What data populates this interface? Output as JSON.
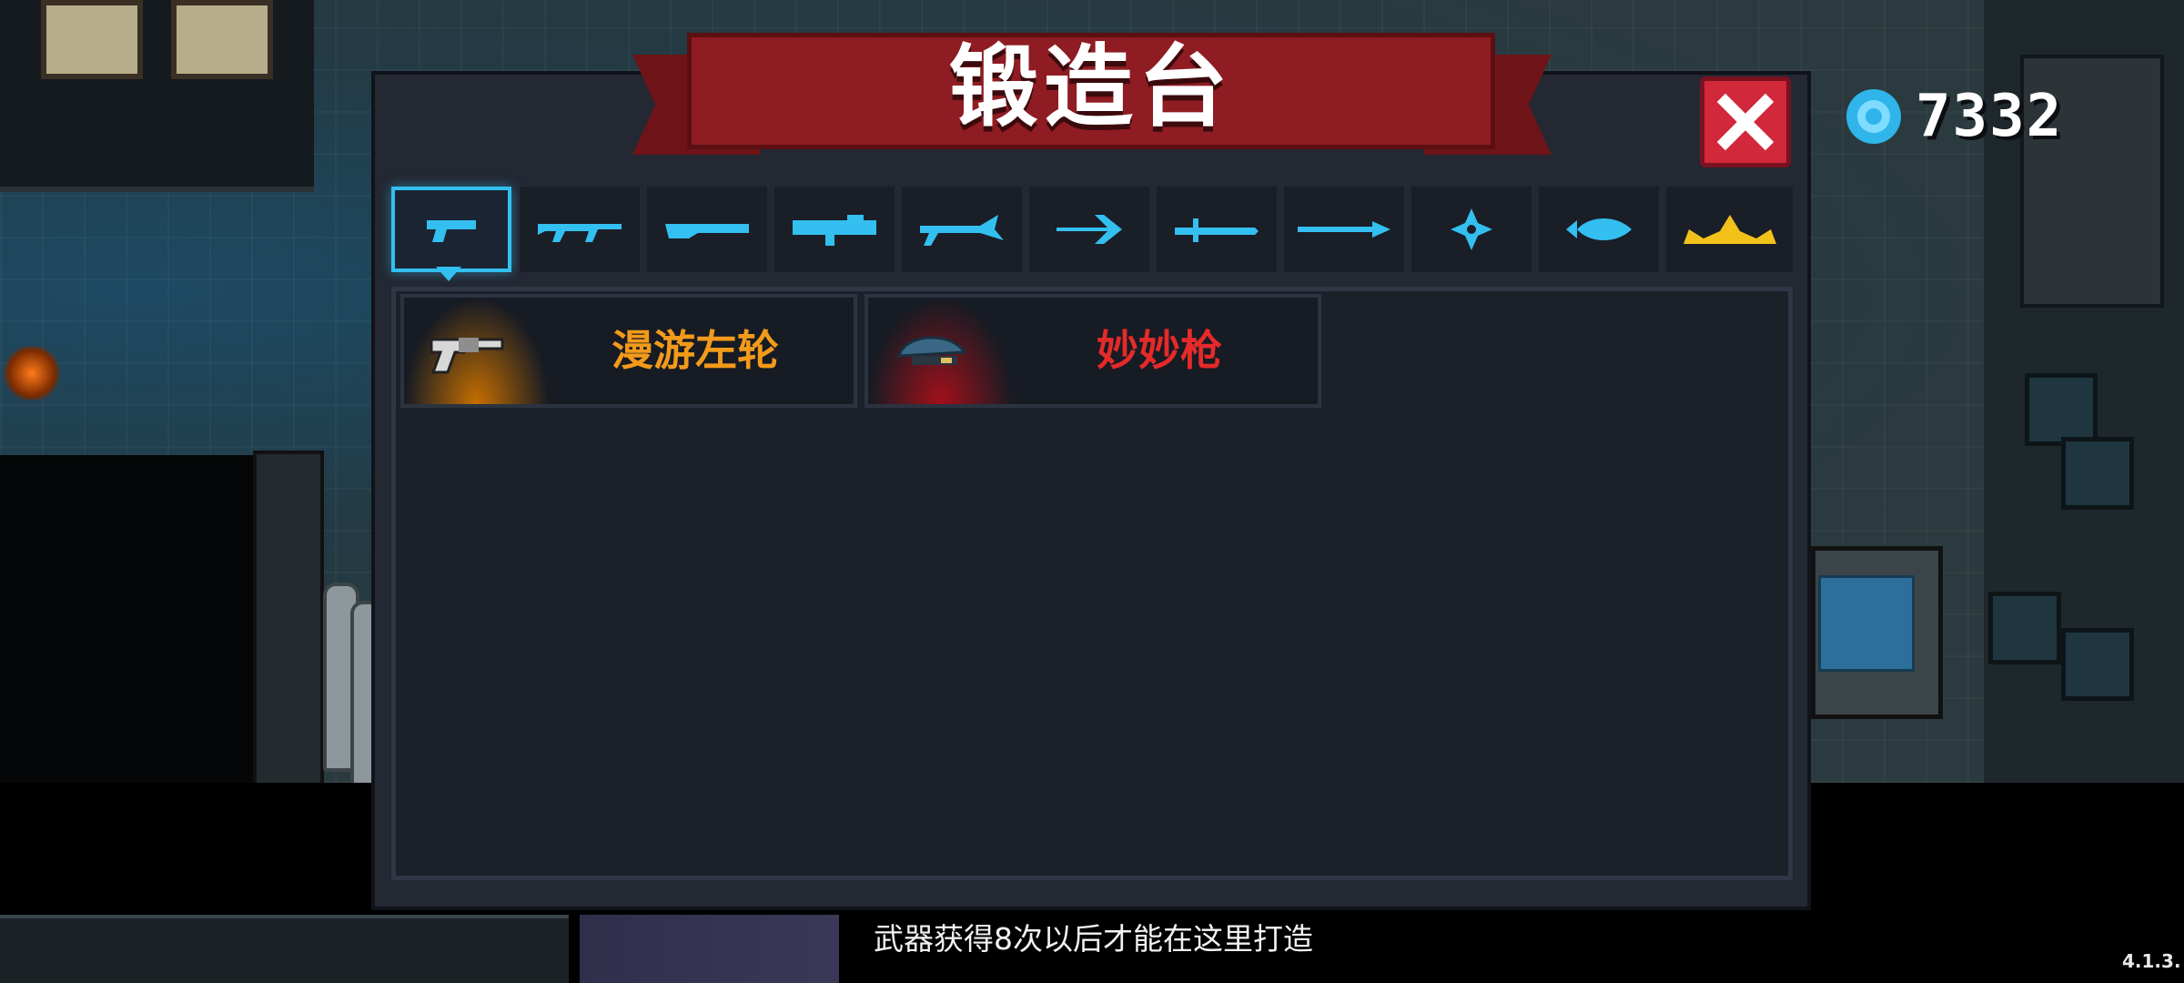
{
  "forge": {
    "title": "锻造台",
    "currency": {
      "icon": "gem-icon",
      "amount": "7332"
    },
    "tabs": [
      {
        "icon": "pistol-icon",
        "active": true
      },
      {
        "icon": "rifle-icon",
        "active": false
      },
      {
        "icon": "shotgun-icon",
        "active": false
      },
      {
        "icon": "rocket-launcher-icon",
        "active": false
      },
      {
        "icon": "laser-gun-icon",
        "active": false
      },
      {
        "icon": "bow-icon",
        "active": false
      },
      {
        "icon": "sword-icon",
        "active": false
      },
      {
        "icon": "spear-icon",
        "active": false
      },
      {
        "icon": "shuriken-icon",
        "active": false
      },
      {
        "icon": "fish-icon",
        "active": false
      },
      {
        "icon": "crown-icon",
        "active": false
      }
    ],
    "items": [
      {
        "name": "漫游左轮",
        "color": "#f29a1a",
        "glow": "#c56f00",
        "icon": "revolver-icon"
      },
      {
        "name": "妙妙枪",
        "color": "#e52a2a",
        "glow": "#a3101a",
        "icon": "turtle-gun-icon"
      }
    ],
    "hint": "武器获得8次以后才能在这里打造",
    "version": "4.1.3."
  },
  "colors": {
    "accent": "#33bff0",
    "banner": "#8e1c22",
    "close": "#d2283b"
  }
}
